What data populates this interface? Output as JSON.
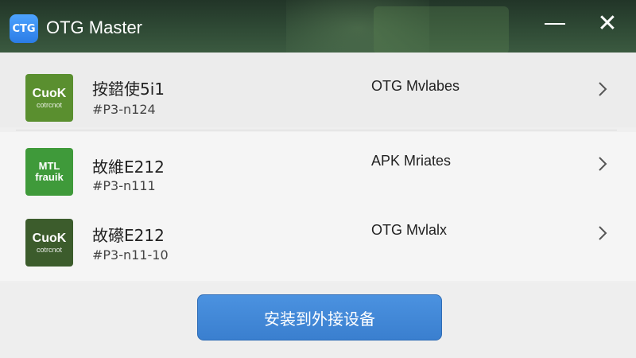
{
  "window": {
    "title": "OTG Master",
    "app_icon_text": "CTG",
    "minimize_icon": "minimize-icon",
    "close_icon": "close-icon"
  },
  "list": {
    "items": [
      {
        "icon": {
          "big": "CuoK",
          "small": "cotrcnot",
          "color": "#5a8f2f"
        },
        "name": "按鍣使5i1",
        "id": "#P3-n124",
        "type": "OTG Mvlabes"
      },
      {
        "icon": {
          "big": "MTL\nfrauik",
          "small": "",
          "color": "#3f9a3a"
        },
        "name": "故維E212",
        "id": "#P3-n111",
        "type": "APK Mriates"
      },
      {
        "icon": {
          "big": "CuoK",
          "small": "cotrcnot",
          "color": "#3c5c2c"
        },
        "name": "故礤E212",
        "id": "#P3-n11-10",
        "type": "OTG Mvlalx"
      }
    ],
    "chevron_icon": "chevron-right-icon"
  },
  "actions": {
    "install_label": "安装到外接设备"
  },
  "colors": {
    "accent": "#3a7fcf",
    "titlebar": "#2f4a35"
  }
}
